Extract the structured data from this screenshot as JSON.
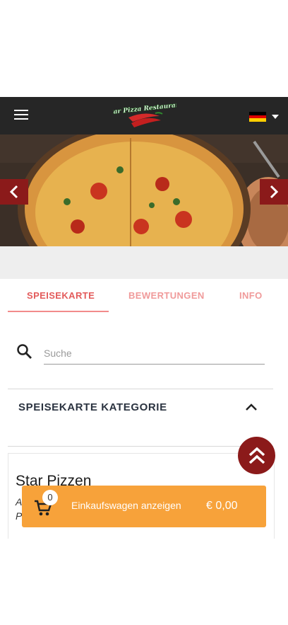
{
  "header": {
    "logo_text": "Star Pizza Restaurant",
    "language_flag": "de-flag",
    "colors": {
      "background": "#262626",
      "accent": "#8b1a1a"
    }
  },
  "tabs": [
    {
      "label": "SPEISEKARTE",
      "active": true,
      "color": "#e35b5b"
    },
    {
      "label": "BEWERTUNGEN",
      "active": false,
      "color": "#f09a9a"
    },
    {
      "label": "INFO",
      "active": false,
      "color": "#f09a9a"
    }
  ],
  "search": {
    "placeholder": "Suche",
    "value": ""
  },
  "category": {
    "title": "SPEISEKARTE KATEGORIE",
    "expanded": true
  },
  "card": {
    "title": "Star Pizzen",
    "line1": "A",
    "line2": "P"
  },
  "cart": {
    "count": "0",
    "label": "Einkaufswagen anzeigen",
    "total": "€ 0,00",
    "color": "#f7a23a"
  }
}
